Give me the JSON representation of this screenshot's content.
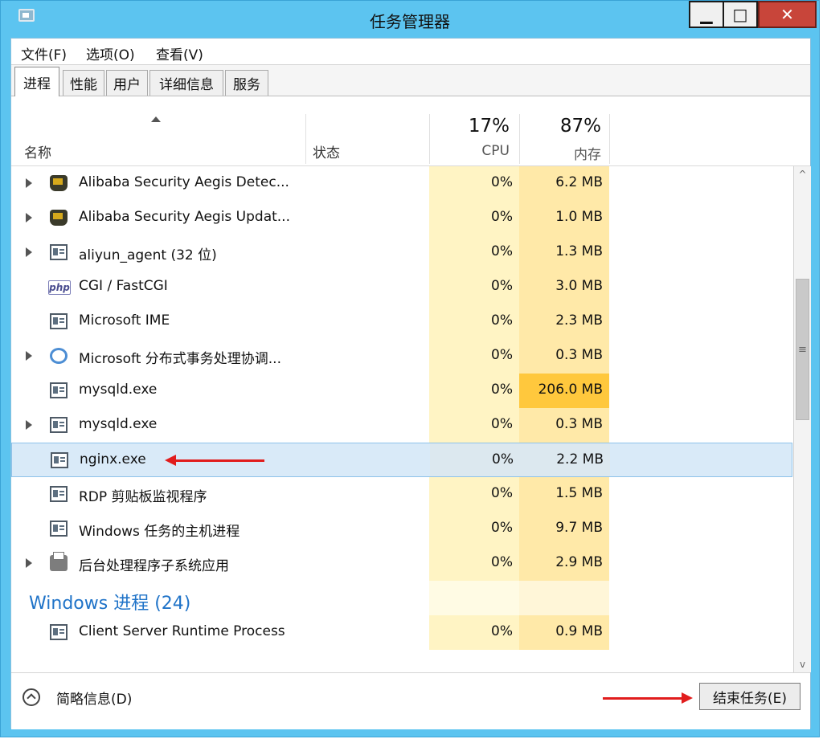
{
  "window": {
    "title": "任务管理器",
    "min_glyph": "▁",
    "max_glyph": "□",
    "close_glyph": "✕",
    "accent": "#5cc4f0"
  },
  "menu": [
    "文件(F)",
    "选项(O)",
    "查看(V)"
  ],
  "tabs": [
    "进程",
    "性能",
    "用户",
    "详细信息",
    "服务"
  ],
  "columns": {
    "name": "名称",
    "status": "状态",
    "cpu_pct": "17%",
    "cpu": "CPU",
    "mem_pct": "87%",
    "mem": "内存"
  },
  "processes": [
    {
      "name": "Alibaba Security Aegis Detec...",
      "cpu": "0%",
      "mem": "6.2 MB",
      "icon": "shield-icon",
      "expandable": true
    },
    {
      "name": "Alibaba Security Aegis Updat...",
      "cpu": "0%",
      "mem": "1.0 MB",
      "icon": "shield-icon",
      "expandable": true
    },
    {
      "name": "aliyun_agent (32 位)",
      "cpu": "0%",
      "mem": "1.3 MB",
      "icon": "app-window-icon",
      "expandable": true
    },
    {
      "name": "CGI / FastCGI",
      "cpu": "0%",
      "mem": "3.0 MB",
      "icon": "php-icon",
      "icon_text": "php",
      "expandable": false
    },
    {
      "name": "Microsoft IME",
      "cpu": "0%",
      "mem": "2.3 MB",
      "icon": "app-window-icon",
      "expandable": false
    },
    {
      "name": "Microsoft 分布式事务处理协调...",
      "cpu": "0%",
      "mem": "0.3 MB",
      "icon": "dtc-icon",
      "expandable": true
    },
    {
      "name": "mysqld.exe",
      "cpu": "0%",
      "mem": "206.0 MB",
      "icon": "app-window-icon",
      "expandable": false,
      "highlight": true
    },
    {
      "name": "mysqld.exe",
      "cpu": "0%",
      "mem": "0.3 MB",
      "icon": "app-window-icon",
      "expandable": true
    },
    {
      "name": "nginx.exe",
      "cpu": "0%",
      "mem": "2.2 MB",
      "icon": "app-window-icon",
      "expandable": false,
      "selected": true
    },
    {
      "name": "RDP 剪贴板监视程序",
      "cpu": "0%",
      "mem": "1.5 MB",
      "icon": "app-window-icon",
      "expandable": false
    },
    {
      "name": "Windows 任务的主机进程",
      "cpu": "0%",
      "mem": "9.7 MB",
      "icon": "app-window-icon",
      "expandable": false
    },
    {
      "name": "后台处理程序子系统应用",
      "cpu": "0%",
      "mem": "2.9 MB",
      "icon": "printer-icon",
      "expandable": true
    }
  ],
  "group_header": "Windows 进程 (24)",
  "group_processes": [
    {
      "name": "Client Server Runtime Process",
      "cpu": "0%",
      "mem": "0.9 MB",
      "icon": "app-window-icon",
      "expandable": false
    }
  ],
  "scrollbar": {
    "up_glyph": "^",
    "down_glyph": "v",
    "grip_glyph": "≡"
  },
  "footer": {
    "fewer_details": "简略信息(D)",
    "end_task": "结束任务(E)"
  }
}
